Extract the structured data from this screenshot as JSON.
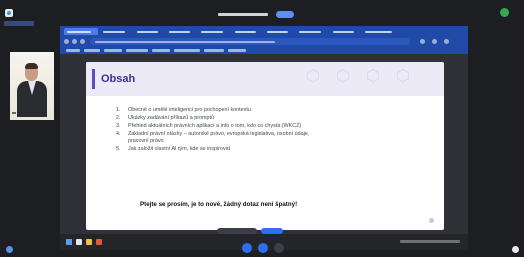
{
  "slide": {
    "title": "Obsah",
    "items": [
      {
        "num": "1.",
        "text": "Obecně o umělé inteligenci pro pochopení kontextu"
      },
      {
        "num": "2.",
        "text": "Ukázky zadávání příkazů a promptů"
      },
      {
        "num": "3.",
        "text": "Přehled aktuálních právních aplikací a info o tom, kdo co chystá (WKCZ)"
      },
      {
        "num": "4.",
        "text": "Základní právní otázky – autorské právo, evropská legislativa, osobní údaje,"
      },
      {
        "num": "",
        "text": "pracovní právo"
      },
      {
        "num": "5.",
        "text": "Jak založit vlastní AI tým, kde se inspirovat"
      }
    ],
    "closing": "Ptejte se prosím, je to nové, žádný dotaz není špatný!"
  },
  "colors": {
    "accent": "#5a4fc4",
    "title": "#3a2f9a",
    "browser_chrome": "#1f4aa8",
    "meeting_bg": "#1c1e22",
    "control_blue": "#2d6ff0"
  },
  "icons": {
    "mic": "mic-icon",
    "camera": "camera-icon",
    "end": "leave-icon"
  }
}
